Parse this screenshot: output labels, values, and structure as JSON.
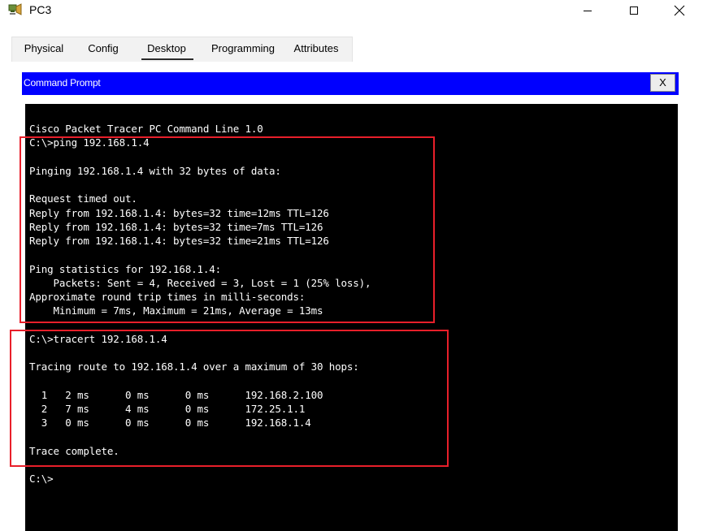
{
  "window": {
    "title": "PC3",
    "controls": {
      "minimize_icon": "minimize-icon",
      "maximize_icon": "maximize-icon",
      "close_icon": "close-icon"
    }
  },
  "tabs": [
    {
      "label": "Physical"
    },
    {
      "label": "Config"
    },
    {
      "label": "Desktop",
      "active": true
    },
    {
      "label": "Programming"
    },
    {
      "label": "Attributes"
    }
  ],
  "command_prompt": {
    "title": "Command Prompt",
    "close_label": "X",
    "lines": [
      "Cisco Packet Tracer PC Command Line 1.0",
      "C:\\>ping 192.168.1.4",
      "",
      "Pinging 192.168.1.4 with 32 bytes of data:",
      "",
      "Request timed out.",
      "Reply from 192.168.1.4: bytes=32 time=12ms TTL=126",
      "Reply from 192.168.1.4: bytes=32 time=7ms TTL=126",
      "Reply from 192.168.1.4: bytes=32 time=21ms TTL=126",
      "",
      "Ping statistics for 192.168.1.4:",
      "    Packets: Sent = 4, Received = 3, Lost = 1 (25% loss),",
      "Approximate round trip times in milli-seconds:",
      "    Minimum = 7ms, Maximum = 21ms, Average = 13ms",
      "",
      "C:\\>tracert 192.168.1.4",
      "",
      "Tracing route to 192.168.1.4 over a maximum of 30 hops:",
      "",
      "  1   2 ms      0 ms      0 ms      192.168.2.100",
      "  2   7 ms      4 ms      0 ms      172.25.1.1",
      "  3   0 ms      0 ms      0 ms      192.168.1.4",
      "",
      "Trace complete.",
      "",
      "C:\\>"
    ]
  },
  "colors": {
    "cmd_titlebar": "#0000ff",
    "terminal_bg": "#000000",
    "terminal_fg": "#ffffff",
    "highlight_box": "#e81f2a"
  }
}
